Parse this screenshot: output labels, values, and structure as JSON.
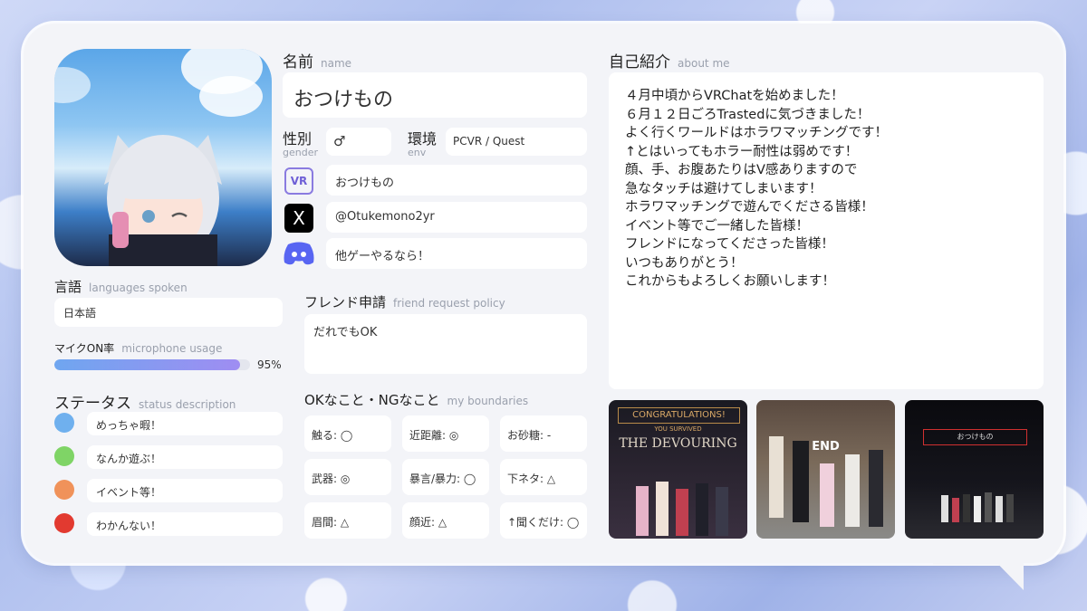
{
  "name": {
    "label": "名前",
    "sub": "name",
    "value": "おつけもの"
  },
  "gender": {
    "label": "性別",
    "sub": "gender",
    "value": "♂"
  },
  "env": {
    "label": "環境",
    "sub": "env",
    "value": "PCVR / Quest"
  },
  "accounts": {
    "vrchat": {
      "icon": "VR",
      "value": "おつけもの"
    },
    "x": {
      "icon": "X",
      "value": "@Otukemono2yr"
    },
    "discord": {
      "value": "他ゲーやるなら！"
    }
  },
  "friend_request": {
    "label": "フレンド申請",
    "sub": "friend request policy",
    "value": "だれでもOK"
  },
  "languages": {
    "label": "言語",
    "sub": "languages spoken",
    "value": "日本語"
  },
  "mic": {
    "label": "マイクON率",
    "sub": "microphone usage",
    "percent_text": "95%",
    "percent": 95
  },
  "status": {
    "label": "ステータス",
    "sub": "status description",
    "items": [
      {
        "color": "#6fb0ee",
        "text": "めっちゃ暇！"
      },
      {
        "color": "#7fd466",
        "text": "なんか遊ぶ！"
      },
      {
        "color": "#f0925a",
        "text": "イベント等！"
      },
      {
        "color": "#e23a30",
        "text": "わかんない！"
      }
    ]
  },
  "boundaries": {
    "label": "OKなこと・NGなこと",
    "sub": "my boundaries",
    "items": [
      "触る: ◯",
      "近距離: ◎",
      "お砂糖: -",
      "武器: ◎",
      "暴言/暴力: ◯",
      "下ネタ: △",
      "眉間: △",
      "顔近: △",
      "↑聞くだけ: ◯"
    ]
  },
  "about": {
    "label": "自己紹介",
    "sub": "about me",
    "lines": [
      "４月中頃からVRChatを始めました！",
      "６月１２日ごろTrastedに気づきました！",
      "よく行くワールドはホラワマッチングです！",
      "↑とはいってもホラー耐性は弱めです！",
      "顔、手、お腹あたりはV感ありますので",
      "急なタッチは避けてしまいます！",
      "ホラワマッチングで遊んでくださる皆様！",
      "イベント等でご一緒した皆様！",
      "フレンドになってくださった皆様！",
      "いつもありがとう！",
      "これからもよろしくお願いします！"
    ]
  },
  "photos": {
    "p1": {
      "banner": "CONGRATULATIONS!",
      "sub": "YOU SURVIVED",
      "title": "THE DEVOURING"
    },
    "p2": {
      "text": "END"
    },
    "p3": {
      "text": "おつけもの"
    }
  },
  "colors": {
    "accent_purple": "#9f8df2",
    "accent_blue": "#6fa6f0",
    "discord": "#5865f2"
  }
}
